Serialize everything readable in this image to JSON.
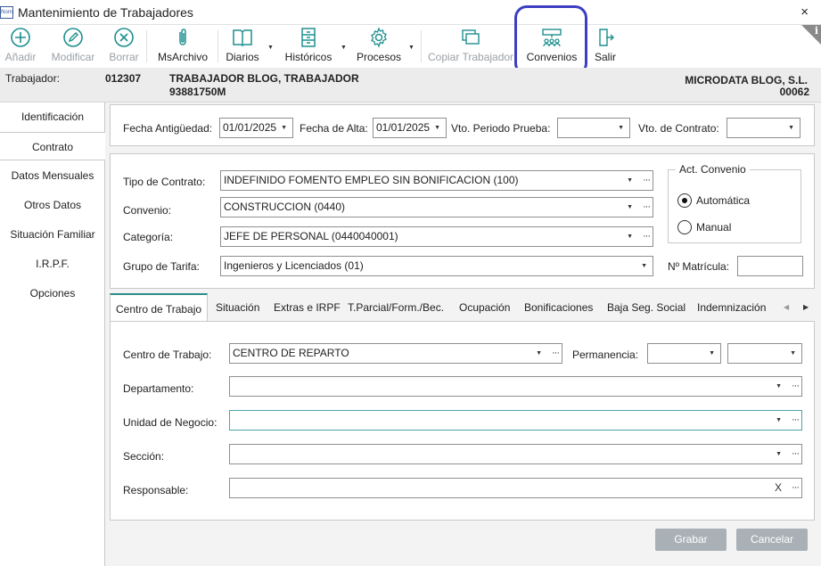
{
  "window": {
    "app_icon_text": "Nom",
    "title": "Mantenimiento de Trabajadores",
    "close": "×"
  },
  "toolbar": {
    "add": "Añadir",
    "edit": "Modificar",
    "delete": "Borrar",
    "msarchivo": "MsArchivo",
    "diarios": "Diarios",
    "historicos": "Históricos",
    "procesos": "Procesos",
    "copy": "Copiar Trabajador",
    "convenios": "Convenios",
    "exit": "Salir",
    "info": "i"
  },
  "header": {
    "worker_label": "Trabajador:",
    "worker_code": "012307",
    "worker_name": "TRABAJADOR BLOG, TRABAJADOR",
    "worker_id": "93881750M",
    "company_name": "MICRODATA BLOG, S.L.",
    "company_code": "00062"
  },
  "sidebar": {
    "items": [
      {
        "label": "Identificación"
      },
      {
        "label": "Contrato"
      },
      {
        "label": "Datos Mensuales"
      },
      {
        "label": "Otros Datos"
      },
      {
        "label": "Situación Familiar"
      },
      {
        "label": "I.R.P.F."
      },
      {
        "label": "Opciones"
      }
    ]
  },
  "dates": {
    "antiguedad_label": "Fecha Antigüedad:",
    "antiguedad_value": "01/01/2025",
    "alta_label": "Fecha de Alta:",
    "alta_value": "01/01/2025",
    "prueba_label": "Vto. Periodo Prueba:",
    "prueba_value": "",
    "contrato_label": "Vto. de Contrato:",
    "contrato_value": ""
  },
  "contract": {
    "tipo_label": "Tipo de Contrato:",
    "tipo_value": "INDEFINIDO FOMENTO EMPLEO SIN BONIFICACION (100)",
    "convenio_label": "Convenio:",
    "convenio_value": "CONSTRUCCION (0440)",
    "categoria_label": "Categoría:",
    "categoria_value": "JEFE DE PERSONAL (0440040001)",
    "grupo_label": "Grupo de Tarifa:",
    "grupo_value": "Ingenieros y Licenciados (01)",
    "matricula_label": "Nº Matrícula:",
    "matricula_value": ""
  },
  "act_convenio": {
    "title": "Act. Convenio",
    "auto": "Automática",
    "manual": "Manual"
  },
  "tabs": [
    {
      "label": "Centro de Trabajo"
    },
    {
      "label": "Situación"
    },
    {
      "label": "Extras e IRPF"
    },
    {
      "label": "T.Parcial/Form./Bec."
    },
    {
      "label": "Ocupación"
    },
    {
      "label": "Bonificaciones"
    },
    {
      "label": "Baja Seg. Social"
    },
    {
      "label": "Indemnización"
    }
  ],
  "centro": {
    "centro_label": "Centro de Trabajo:",
    "centro_value": "CENTRO DE REPARTO",
    "permanencia_label": "Permanencia:",
    "departamento_label": "Departamento:",
    "unidad_label": "Unidad de Negocio:",
    "seccion_label": "Sección:",
    "responsable_label": "Responsable:",
    "responsable_clear": "X"
  },
  "actions": {
    "save": "Grabar",
    "cancel": "Cancelar"
  }
}
